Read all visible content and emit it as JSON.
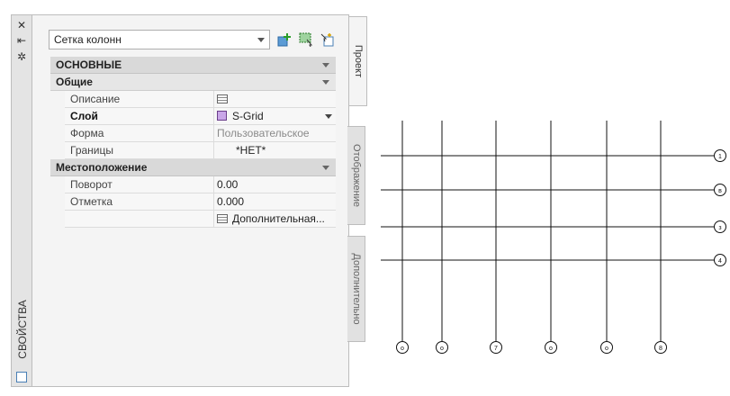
{
  "palette": {
    "title": "СВОЙСТВА",
    "titlebar_icons": [
      "close-icon",
      "auto-hide-icon",
      "settings-icon"
    ],
    "style_select": {
      "value": "Сетка колонн"
    },
    "toolbar_icons": [
      "add-object-icon",
      "quick-select-icon",
      "toggle-pickadd-icon"
    ],
    "categories": [
      {
        "label": "ОСНОВНЫЕ",
        "sub": "Общие",
        "rows": [
          {
            "name": "Описание",
            "value": "",
            "kind": "table-icon"
          },
          {
            "name": "Слой",
            "value": "S-Grid",
            "kind": "layer"
          },
          {
            "name": "Форма",
            "value": "Пользовательское",
            "kind": "grey"
          },
          {
            "name": "Границы",
            "value": "*НЕТ*",
            "kind": "text"
          }
        ]
      },
      {
        "label": "Местоположение",
        "rows": [
          {
            "name": "Поворот",
            "value": "0.00"
          },
          {
            "name": "Отметка",
            "value": "0.000"
          },
          {
            "name": "",
            "value": "Дополнительная..."
          }
        ]
      }
    ],
    "tabs": [
      "Проект",
      "Отображение",
      "Дополнительно"
    ]
  },
  "grid": {
    "row_bubbles": [
      "1",
      "в",
      "з",
      "4"
    ],
    "column_bubbles": [
      "о",
      "о",
      "7",
      "о",
      "о",
      "8"
    ]
  }
}
